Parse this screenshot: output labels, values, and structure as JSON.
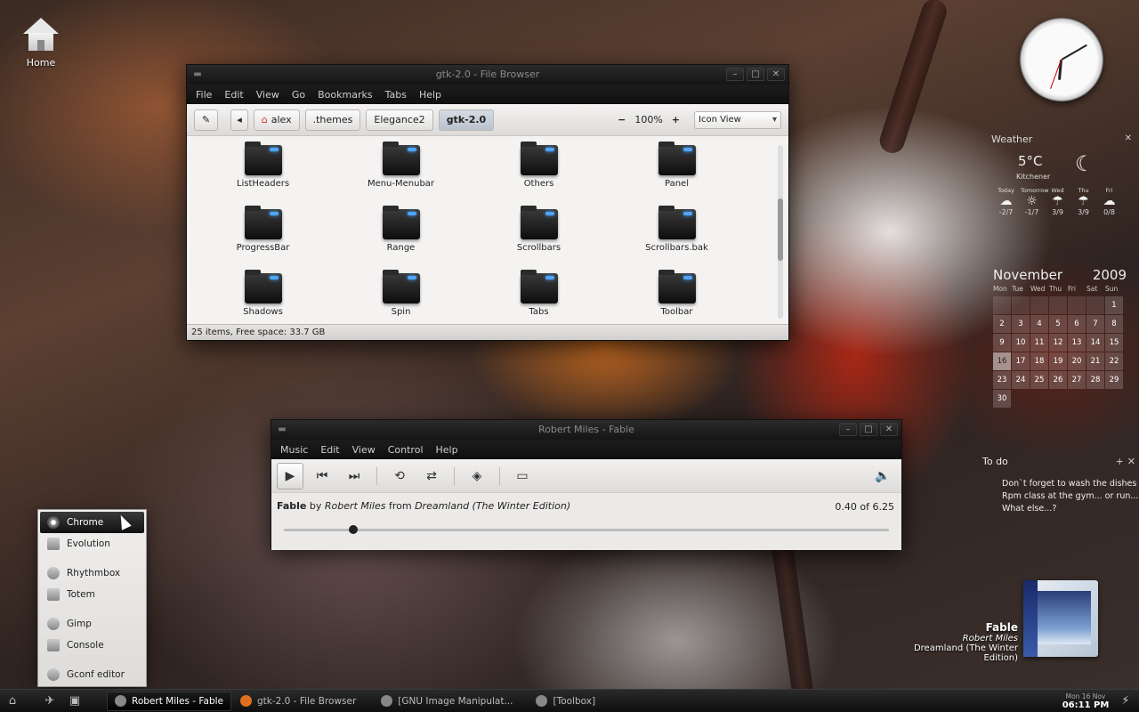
{
  "desktop": {
    "icons": [
      {
        "label": "Home",
        "icon": "home-icon"
      }
    ]
  },
  "file_browser": {
    "title": "gtk-2.0 - File Browser",
    "menu": [
      "File",
      "Edit",
      "View",
      "Go",
      "Bookmarks",
      "Tabs",
      "Help"
    ],
    "breadcrumbs": [
      "alex",
      ".themes",
      "Elegance2",
      "gtk-2.0"
    ],
    "zoom": "100%",
    "view_mode": "Icon View",
    "items": [
      "ListHeaders",
      "Menu-Menubar",
      "Others",
      "Panel",
      "ProgressBar",
      "Range",
      "Scrollbars",
      "Scrollbars.bak",
      "Shadows",
      "Spin",
      "Tabs",
      "Toolbar"
    ],
    "status": "25 items, Free space: 33.7 GB"
  },
  "music_player": {
    "title": "Robert Miles - Fable",
    "menu": [
      "Music",
      "Edit",
      "View",
      "Control",
      "Help"
    ],
    "track": "Fable",
    "by_word": "by",
    "artist": "Robert Miles",
    "from_word": "from",
    "album": "Dreamland (The Winter Edition)",
    "time": "0.40 of 6.25",
    "progress": 0.107
  },
  "app_menu": {
    "items": [
      "Chrome",
      "Evolution",
      "Rhythmbox",
      "Totem",
      "Gimp",
      "Console",
      "Gconf editor"
    ],
    "selected": "Chrome"
  },
  "weather": {
    "title": "Weather",
    "temperature": "5°C",
    "city": "Kitchener",
    "days": [
      {
        "name": "Today",
        "temp": "-2/7",
        "icon": "cloud-snow-icon"
      },
      {
        "name": "Tomorrow",
        "temp": "-1/7",
        "icon": "sun-icon"
      },
      {
        "name": "Wed",
        "temp": "3/9",
        "icon": "cloud-rain-icon"
      },
      {
        "name": "Thu",
        "temp": "3/9",
        "icon": "cloud-rain-icon"
      },
      {
        "name": "Fri",
        "temp": "0/8",
        "icon": "cloud-snow-icon"
      }
    ]
  },
  "calendar": {
    "month": "November",
    "year": "2009",
    "weekdays": [
      "Mon",
      "Tue",
      "Wed",
      "Thu",
      "Fri",
      "Sat",
      "Sun"
    ],
    "days": [
      "",
      "",
      "",
      "",
      "",
      "",
      "1",
      "2",
      "3",
      "4",
      "5",
      "6",
      "7",
      "8",
      "9",
      "10",
      "11",
      "12",
      "13",
      "14",
      "15",
      "16",
      "17",
      "18",
      "19",
      "20",
      "21",
      "22",
      "23",
      "24",
      "25",
      "26",
      "27",
      "28",
      "29",
      "30"
    ],
    "today": "16"
  },
  "todo": {
    "title": "To do",
    "items": [
      "Don`t forget to wash the dishes",
      "Rpm class at the gym... or run...",
      "What else...?"
    ]
  },
  "now_playing": {
    "title": "Fable",
    "artist": "Robert Miles",
    "album": "Dreamland (The Winter Edition)"
  },
  "taskbar": {
    "tasks": [
      "Robert Miles - Fable",
      "gtk-2.0 - File Browser",
      "[GNU Image Manipulat...",
      "[Toolbox]"
    ],
    "active_task": "Robert Miles - Fable",
    "date": "Mon 16 Nov",
    "time": "06:11 PM"
  }
}
